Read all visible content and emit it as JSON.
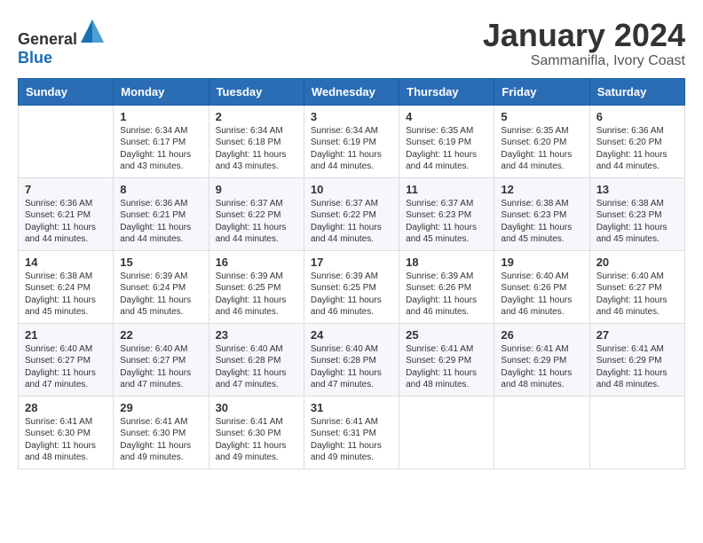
{
  "header": {
    "logo_general": "General",
    "logo_blue": "Blue",
    "month_title": "January 2024",
    "location": "Sammanifla, Ivory Coast"
  },
  "days_of_week": [
    "Sunday",
    "Monday",
    "Tuesday",
    "Wednesday",
    "Thursday",
    "Friday",
    "Saturday"
  ],
  "weeks": [
    [
      {
        "day": "",
        "content": ""
      },
      {
        "day": "1",
        "content": "Sunrise: 6:34 AM\nSunset: 6:17 PM\nDaylight: 11 hours\nand 43 minutes."
      },
      {
        "day": "2",
        "content": "Sunrise: 6:34 AM\nSunset: 6:18 PM\nDaylight: 11 hours\nand 43 minutes."
      },
      {
        "day": "3",
        "content": "Sunrise: 6:34 AM\nSunset: 6:19 PM\nDaylight: 11 hours\nand 44 minutes."
      },
      {
        "day": "4",
        "content": "Sunrise: 6:35 AM\nSunset: 6:19 PM\nDaylight: 11 hours\nand 44 minutes."
      },
      {
        "day": "5",
        "content": "Sunrise: 6:35 AM\nSunset: 6:20 PM\nDaylight: 11 hours\nand 44 minutes."
      },
      {
        "day": "6",
        "content": "Sunrise: 6:36 AM\nSunset: 6:20 PM\nDaylight: 11 hours\nand 44 minutes."
      }
    ],
    [
      {
        "day": "7",
        "content": "Sunrise: 6:36 AM\nSunset: 6:21 PM\nDaylight: 11 hours\nand 44 minutes."
      },
      {
        "day": "8",
        "content": "Sunrise: 6:36 AM\nSunset: 6:21 PM\nDaylight: 11 hours\nand 44 minutes."
      },
      {
        "day": "9",
        "content": "Sunrise: 6:37 AM\nSunset: 6:22 PM\nDaylight: 11 hours\nand 44 minutes."
      },
      {
        "day": "10",
        "content": "Sunrise: 6:37 AM\nSunset: 6:22 PM\nDaylight: 11 hours\nand 44 minutes."
      },
      {
        "day": "11",
        "content": "Sunrise: 6:37 AM\nSunset: 6:23 PM\nDaylight: 11 hours\nand 45 minutes."
      },
      {
        "day": "12",
        "content": "Sunrise: 6:38 AM\nSunset: 6:23 PM\nDaylight: 11 hours\nand 45 minutes."
      },
      {
        "day": "13",
        "content": "Sunrise: 6:38 AM\nSunset: 6:23 PM\nDaylight: 11 hours\nand 45 minutes."
      }
    ],
    [
      {
        "day": "14",
        "content": "Sunrise: 6:38 AM\nSunset: 6:24 PM\nDaylight: 11 hours\nand 45 minutes."
      },
      {
        "day": "15",
        "content": "Sunrise: 6:39 AM\nSunset: 6:24 PM\nDaylight: 11 hours\nand 45 minutes."
      },
      {
        "day": "16",
        "content": "Sunrise: 6:39 AM\nSunset: 6:25 PM\nDaylight: 11 hours\nand 46 minutes."
      },
      {
        "day": "17",
        "content": "Sunrise: 6:39 AM\nSunset: 6:25 PM\nDaylight: 11 hours\nand 46 minutes."
      },
      {
        "day": "18",
        "content": "Sunrise: 6:39 AM\nSunset: 6:26 PM\nDaylight: 11 hours\nand 46 minutes."
      },
      {
        "day": "19",
        "content": "Sunrise: 6:40 AM\nSunset: 6:26 PM\nDaylight: 11 hours\nand 46 minutes."
      },
      {
        "day": "20",
        "content": "Sunrise: 6:40 AM\nSunset: 6:27 PM\nDaylight: 11 hours\nand 46 minutes."
      }
    ],
    [
      {
        "day": "21",
        "content": "Sunrise: 6:40 AM\nSunset: 6:27 PM\nDaylight: 11 hours\nand 47 minutes."
      },
      {
        "day": "22",
        "content": "Sunrise: 6:40 AM\nSunset: 6:27 PM\nDaylight: 11 hours\nand 47 minutes."
      },
      {
        "day": "23",
        "content": "Sunrise: 6:40 AM\nSunset: 6:28 PM\nDaylight: 11 hours\nand 47 minutes."
      },
      {
        "day": "24",
        "content": "Sunrise: 6:40 AM\nSunset: 6:28 PM\nDaylight: 11 hours\nand 47 minutes."
      },
      {
        "day": "25",
        "content": "Sunrise: 6:41 AM\nSunset: 6:29 PM\nDaylight: 11 hours\nand 48 minutes."
      },
      {
        "day": "26",
        "content": "Sunrise: 6:41 AM\nSunset: 6:29 PM\nDaylight: 11 hours\nand 48 minutes."
      },
      {
        "day": "27",
        "content": "Sunrise: 6:41 AM\nSunset: 6:29 PM\nDaylight: 11 hours\nand 48 minutes."
      }
    ],
    [
      {
        "day": "28",
        "content": "Sunrise: 6:41 AM\nSunset: 6:30 PM\nDaylight: 11 hours\nand 48 minutes."
      },
      {
        "day": "29",
        "content": "Sunrise: 6:41 AM\nSunset: 6:30 PM\nDaylight: 11 hours\nand 49 minutes."
      },
      {
        "day": "30",
        "content": "Sunrise: 6:41 AM\nSunset: 6:30 PM\nDaylight: 11 hours\nand 49 minutes."
      },
      {
        "day": "31",
        "content": "Sunrise: 6:41 AM\nSunset: 6:31 PM\nDaylight: 11 hours\nand 49 minutes."
      },
      {
        "day": "",
        "content": ""
      },
      {
        "day": "",
        "content": ""
      },
      {
        "day": "",
        "content": ""
      }
    ]
  ]
}
